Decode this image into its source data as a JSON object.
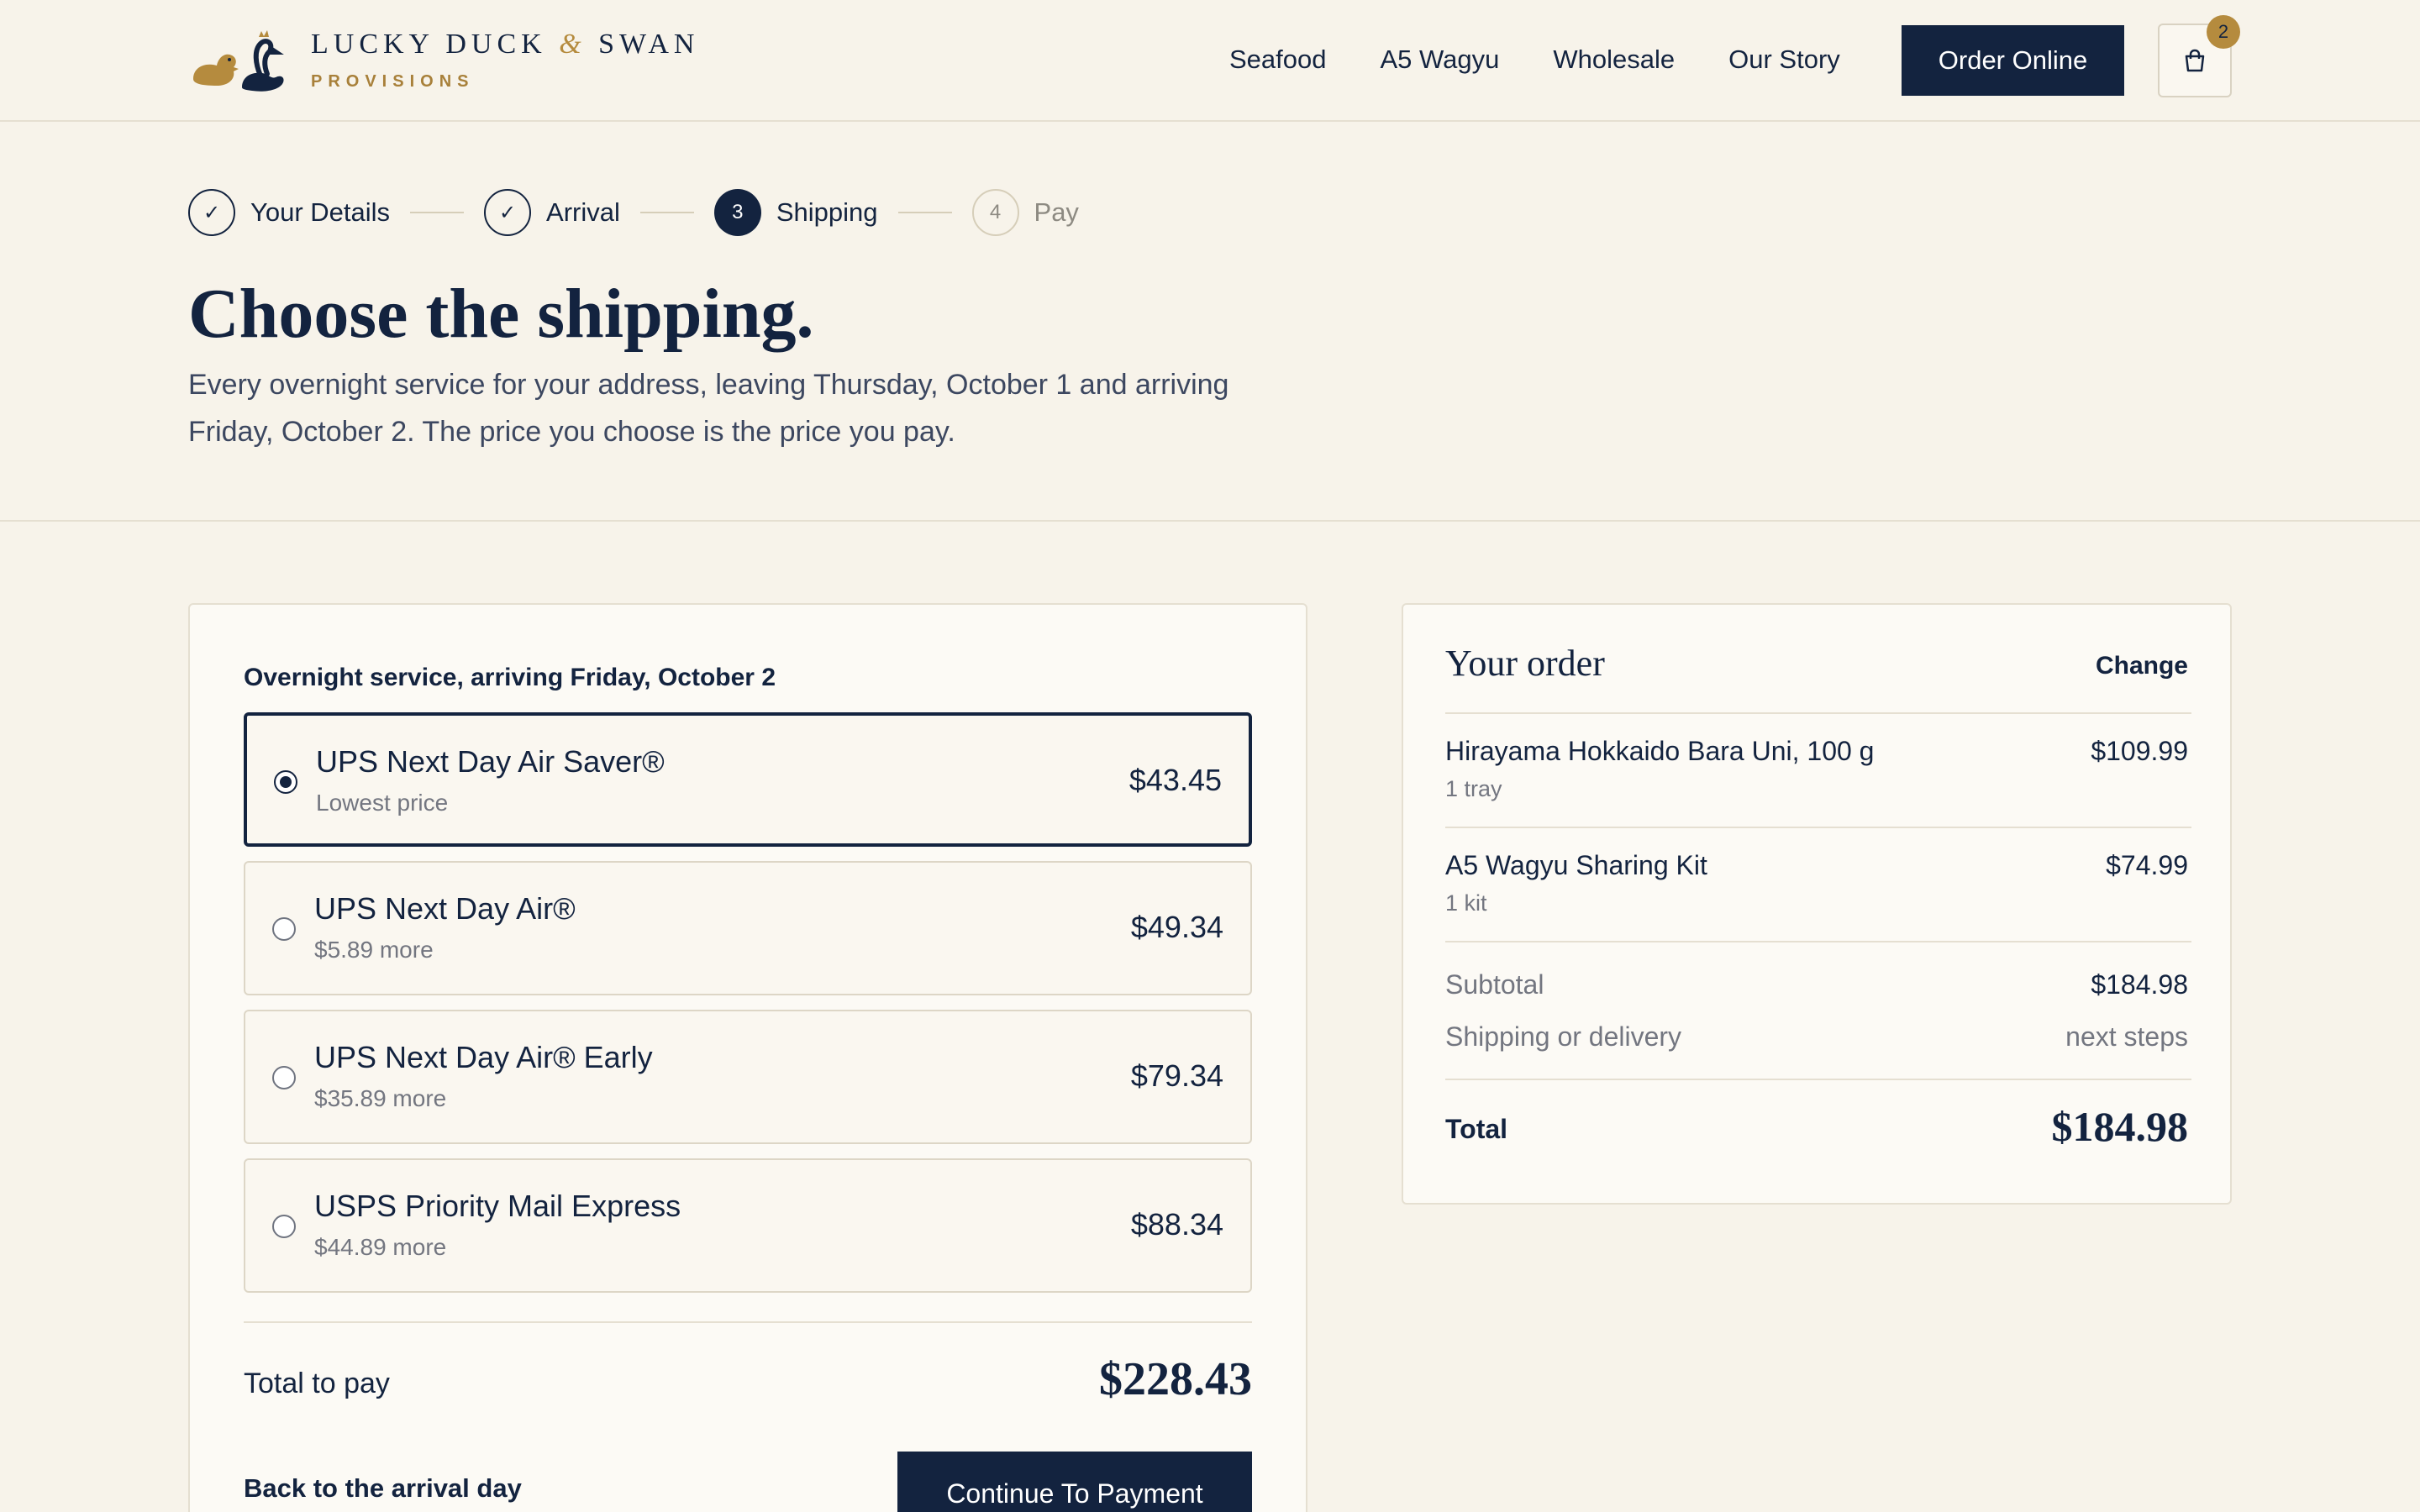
{
  "brand": {
    "name_part1": "LUCKY DUCK",
    "ampersand": "&",
    "name_part2": "SWAN",
    "tagline": "PROVISIONS"
  },
  "nav": {
    "items": [
      "Seafood",
      "A5 Wagyu",
      "Wholesale",
      "Our Story"
    ],
    "order_button": "Order Online",
    "cart_count": "2"
  },
  "stepper": {
    "steps": [
      {
        "marker": "✓",
        "label": "Your Details",
        "state": "done"
      },
      {
        "marker": "✓",
        "label": "Arrival",
        "state": "done"
      },
      {
        "marker": "3",
        "label": "Shipping",
        "state": "active"
      },
      {
        "marker": "4",
        "label": "Pay",
        "state": "pending"
      }
    ]
  },
  "page": {
    "title": "Choose the shipping.",
    "description": "Every overnight service for your address, leaving Thursday, October 1 and arriving Friday, October 2. The price you choose is the price you pay."
  },
  "shipping": {
    "heading": "Overnight service, arriving Friday, October 2",
    "options": [
      {
        "name": "UPS Next Day Air Saver®",
        "note": "Lowest price",
        "price": "$43.45",
        "selected": true
      },
      {
        "name": "UPS Next Day Air®",
        "note": "$5.89 more",
        "price": "$49.34",
        "selected": false
      },
      {
        "name": "UPS Next Day Air® Early",
        "note": "$35.89 more",
        "price": "$79.34",
        "selected": false
      },
      {
        "name": "USPS Priority Mail Express",
        "note": "$44.89 more",
        "price": "$88.34",
        "selected": false
      }
    ],
    "total_label": "Total to pay",
    "total_value": "$228.43",
    "back_label": "Back to the arrival day",
    "continue_label": "Continue To Payment"
  },
  "order": {
    "title": "Your order",
    "change_label": "Change",
    "items": [
      {
        "name": "Hirayama Hokkaido Bara Uni, 100 g",
        "qty": "1 tray",
        "price": "$109.99"
      },
      {
        "name": "A5 Wagyu Sharing Kit",
        "qty": "1 kit",
        "price": "$74.99"
      }
    ],
    "subtotal_label": "Subtotal",
    "subtotal_value": "$184.98",
    "shipping_label": "Shipping or delivery",
    "shipping_value": "next steps",
    "total_label": "Total",
    "total_value": "$184.98"
  },
  "colors": {
    "navy": "#13233f",
    "gold": "#b58b3e",
    "cream": "#f7f3ea"
  }
}
